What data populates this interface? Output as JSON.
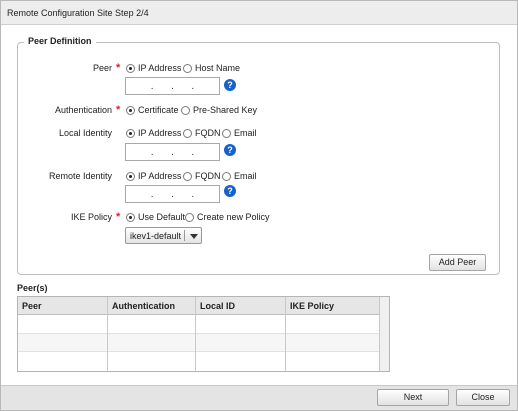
{
  "window": {
    "title": "Remote Configuration Site  Step 2/4"
  },
  "peer_definition": {
    "legend": "Peer Definition",
    "peer": {
      "label": "Peer",
      "options": [
        "IP Address",
        "Host Name"
      ],
      "selected": "IP Address",
      "ip_value": ".    .    ."
    },
    "authentication": {
      "label": "Authentication",
      "options": [
        "Certificate",
        "Pre-Shared Key"
      ],
      "selected": "Certificate"
    },
    "local_identity": {
      "label": "Local Identity",
      "options": [
        "IP Address",
        "FQDN",
        "Email"
      ],
      "selected": "IP Address",
      "ip_value": ".    .    ."
    },
    "remote_identity": {
      "label": "Remote Identity",
      "options": [
        "IP Address",
        "FQDN",
        "Email"
      ],
      "selected": "IP Address",
      "ip_value": ".    .    ."
    },
    "ike_policy": {
      "label": "IKE Policy",
      "options": [
        "Use Default",
        "Create new Policy"
      ],
      "selected": "Use Default",
      "select_value": "ikev1-default"
    },
    "add_peer_label": "Add Peer",
    "help_glyph": "?",
    "required_glyph": "*"
  },
  "peers": {
    "title": "Peer(s)",
    "columns": [
      "Peer",
      "Authentication",
      "Local ID",
      "IKE Policy"
    ],
    "rows": []
  },
  "footer": {
    "next_label": "Next",
    "close_label": "Close"
  },
  "colors": {
    "required": "#d9232e",
    "help": "#1762c8",
    "titlebar": "#ededed",
    "footer": "#e4e4e4"
  },
  "icons": {
    "help": "help-icon",
    "dropdown": "chevron-down-icon"
  }
}
